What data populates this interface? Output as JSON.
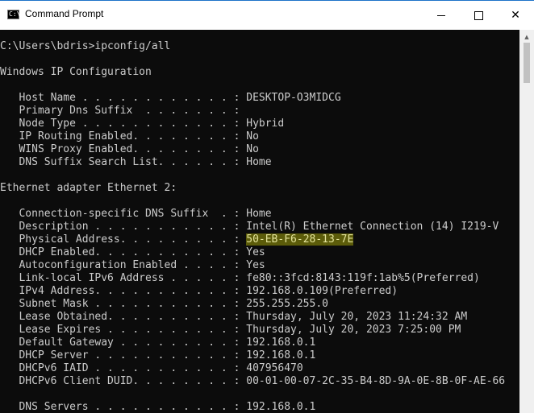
{
  "window": {
    "title": "Command Prompt",
    "icon_text": "C:\\",
    "minimize_glyph": "—",
    "maximize_glyph": "☐",
    "close_glyph": "✕"
  },
  "terminal": {
    "lines": [
      "C:\\Users\\bdris>ipconfig/all",
      "",
      "Windows IP Configuration",
      "",
      "   Host Name . . . . . . . . . . . . : DESKTOP-O3MIDCG",
      "   Primary Dns Suffix  . . . . . . . :",
      "   Node Type . . . . . . . . . . . . : Hybrid",
      "   IP Routing Enabled. . . . . . . . : No",
      "   WINS Proxy Enabled. . . . . . . . : No",
      "   DNS Suffix Search List. . . . . . : Home",
      "",
      "Ethernet adapter Ethernet 2:",
      "",
      "   Connection-specific DNS Suffix  . : Home",
      "   Description . . . . . . . . . . . : Intel(R) Ethernet Connection (14) I219-V",
      "   Physical Address. . . . . . . . . : 50-EB-F6-28-13-7E",
      "   DHCP Enabled. . . . . . . . . . . : Yes",
      "   Autoconfiguration Enabled . . . . : Yes",
      "   Link-local IPv6 Address . . . . . : fe80::3fcd:8143:119f:1ab%5(Preferred)",
      "   IPv4 Address. . . . . . . . . . . : 192.168.0.109(Preferred)",
      "   Subnet Mask . . . . . . . . . . . : 255.255.255.0",
      "   Lease Obtained. . . . . . . . . . : Thursday, July 20, 2023 11:24:32 AM",
      "   Lease Expires . . . . . . . . . . : Thursday, July 20, 2023 7:25:00 PM",
      "   Default Gateway . . . . . . . . . : 192.168.0.1",
      "   DHCP Server . . . . . . . . . . . : 192.168.0.1",
      "   DHCPv6 IAID . . . . . . . . . . . : 407956470",
      "   DHCPv6 Client DUID. . . . . . . . : 00-01-00-07-2C-35-B4-8D-9A-0E-8B-0F-AE-66",
      "",
      "   DNS Servers . . . . . . . . . . . : 192.168.0.1"
    ],
    "highlight": {
      "line": 15,
      "text": "50-EB-F6-28-13-7E",
      "color": "#5c5c0a"
    }
  },
  "scrollbar": {
    "up_arrow_glyph": "▲"
  }
}
